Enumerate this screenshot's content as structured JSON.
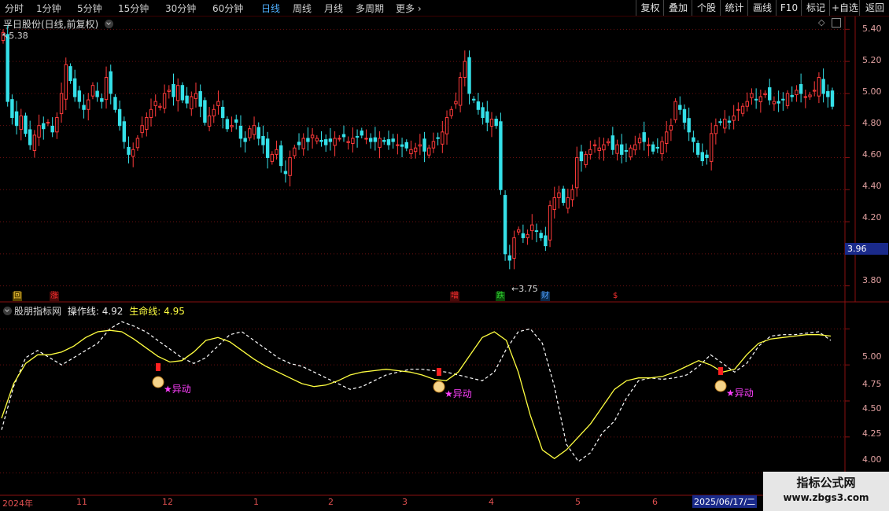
{
  "timeframes": [
    "分时",
    "1分钟",
    "5分钟",
    "15分钟",
    "30分钟",
    "60分钟",
    "日线",
    "周线",
    "月线",
    "多周期",
    "更多"
  ],
  "active_timeframe": "日线",
  "toolbar": [
    "复权",
    "叠加",
    "个股",
    "统计",
    "画线",
    "F10",
    "标记",
    "+自选",
    "返回"
  ],
  "main_chart": {
    "title": "孚日股份(日线,前复权)",
    "high_label": "5.38",
    "low_label": "3.75",
    "current_price": "3.96",
    "yticks": [
      "5.40",
      "5.20",
      "5.00",
      "4.80",
      "4.60",
      "4.40",
      "4.20",
      "3.80"
    ],
    "markers": [
      {
        "text": "回",
        "color": "#ffd040"
      },
      {
        "text": "涨",
        "color": "#ff3030"
      },
      {
        "text": "增",
        "color": "#ff3030"
      },
      {
        "text": "跌",
        "color": "#30d030"
      },
      {
        "text": "财",
        "color": "#4fa0ff"
      },
      {
        "text": "$",
        "color": "#ff3030"
      }
    ]
  },
  "indicator": {
    "name": "股朋指标网",
    "op_label": "操作线:",
    "op_value": "4.92",
    "life_label": "生命线:",
    "life_value": "4.95",
    "yticks": [
      "5.00",
      "4.75",
      "4.50",
      "4.25",
      "4.00"
    ],
    "signal_text": "★异动",
    "signals": [
      "★异动",
      "★异动",
      "★异动"
    ]
  },
  "time_axis": [
    "2024年",
    "11",
    "12",
    "1",
    "2",
    "3",
    "4",
    "5",
    "6"
  ],
  "date_box": "2025/06/17/二",
  "watermark": {
    "title": "指标公式网",
    "url": "www.zbgs3.com"
  },
  "colors": {
    "up": "#ff3a3a",
    "down": "#35e0e8",
    "life_line": "#ffff40",
    "op_line": "#ffffff",
    "signal": "#ff40ff"
  },
  "chart_data": {
    "type": "line",
    "title": "",
    "ylim": [
      3.7,
      5.48
    ],
    "closes": [
      5.38,
      4.95,
      4.85,
      4.8,
      4.86,
      4.75,
      4.68,
      4.74,
      4.8,
      4.78,
      4.82,
      4.76,
      4.85,
      5.0,
      5.18,
      5.08,
      4.98,
      4.95,
      4.9,
      4.96,
      5.05,
      4.98,
      4.95,
      5.1,
      5.0,
      4.9,
      4.8,
      4.7,
      4.62,
      4.65,
      4.72,
      4.8,
      4.85,
      4.9,
      4.95,
      4.92,
      5.0,
      5.02,
      4.98,
      5.05,
      4.96,
      4.94,
      4.98,
      5.0,
      4.92,
      4.82,
      4.86,
      4.9,
      4.95,
      4.85,
      4.78,
      4.8,
      4.82,
      4.72,
      4.7,
      4.78,
      4.8,
      4.72,
      4.68,
      4.6,
      4.62,
      4.65,
      4.55,
      4.5,
      4.6,
      4.66,
      4.68,
      4.72,
      4.7,
      4.74,
      4.72,
      4.7,
      4.68,
      4.7,
      4.72,
      4.72,
      4.73,
      4.7,
      4.72,
      4.73,
      4.74,
      4.72,
      4.7,
      4.7,
      4.72,
      4.7,
      4.68,
      4.7,
      4.68,
      4.67,
      4.66,
      4.65,
      4.66,
      4.68,
      4.64,
      4.66,
      4.7,
      4.72,
      4.76,
      4.85,
      4.9,
      4.95,
      5.1,
      5.2,
      5.0,
      4.96,
      4.9,
      4.85,
      4.82,
      4.84,
      4.8,
      4.4,
      4.0,
      3.96,
      4.1,
      4.15,
      4.1,
      4.12,
      4.18,
      4.14,
      4.1,
      4.05,
      4.3,
      4.35,
      4.38,
      4.32,
      4.35,
      4.4,
      4.6,
      4.58,
      4.62,
      4.65,
      4.68,
      4.66,
      4.68,
      4.7,
      4.65,
      4.68,
      4.62,
      4.64,
      4.66,
      4.68,
      4.72,
      4.7,
      4.68,
      4.64,
      4.66,
      4.7,
      4.76,
      4.8,
      4.95,
      4.9,
      4.82,
      4.76,
      4.7,
      4.62,
      4.58,
      4.6,
      4.75,
      4.8,
      4.82,
      4.84,
      4.82,
      4.86,
      4.9,
      4.92,
      4.95,
      5.0,
      4.96,
      4.98,
      5.0,
      4.96,
      4.95,
      4.94,
      4.96,
      5.0,
      4.98,
      5.02,
      5.0,
      4.98,
      4.99,
      5.02,
      5.1,
      5.0,
      4.98,
      4.92
    ],
    "op_line": [
      4.3,
      4.6,
      4.8,
      4.85,
      4.8,
      4.75,
      4.8,
      4.85,
      4.9,
      5.0,
      5.05,
      5.02,
      4.98,
      4.92,
      4.86,
      4.8,
      4.76,
      4.8,
      4.88,
      4.96,
      4.98,
      4.92,
      4.86,
      4.8,
      4.76,
      4.74,
      4.7,
      4.66,
      4.62,
      4.58,
      4.6,
      4.64,
      4.68,
      4.7,
      4.72,
      4.72,
      4.71,
      4.7,
      4.68,
      4.66,
      4.64,
      4.7,
      4.86,
      4.98,
      5.0,
      4.9,
      4.6,
      4.2,
      4.08,
      4.14,
      4.28,
      4.36,
      4.52,
      4.64,
      4.66,
      4.65,
      4.66,
      4.68,
      4.74,
      4.82,
      4.76,
      4.7,
      4.76,
      4.88,
      4.95,
      4.96,
      4.96,
      4.97,
      4.98,
      4.92
    ],
    "life_line": [
      4.38,
      4.62,
      4.76,
      4.82,
      4.82,
      4.84,
      4.88,
      4.94,
      4.98,
      4.99,
      4.98,
      4.93,
      4.87,
      4.81,
      4.77,
      4.78,
      4.84,
      4.92,
      4.94,
      4.91,
      4.85,
      4.79,
      4.74,
      4.7,
      4.66,
      4.62,
      4.6,
      4.61,
      4.64,
      4.68,
      4.7,
      4.71,
      4.72,
      4.71,
      4.7,
      4.68,
      4.65,
      4.64,
      4.7,
      4.82,
      4.94,
      4.98,
      4.92,
      4.7,
      4.4,
      4.16,
      4.1,
      4.16,
      4.25,
      4.34,
      4.46,
      4.58,
      4.64,
      4.66,
      4.66,
      4.67,
      4.7,
      4.74,
      4.78,
      4.75,
      4.7,
      4.72,
      4.82,
      4.9,
      4.93,
      4.94,
      4.95,
      4.96,
      4.96,
      4.95
    ],
    "indicator_ylim": [
      3.9,
      5.1
    ]
  }
}
